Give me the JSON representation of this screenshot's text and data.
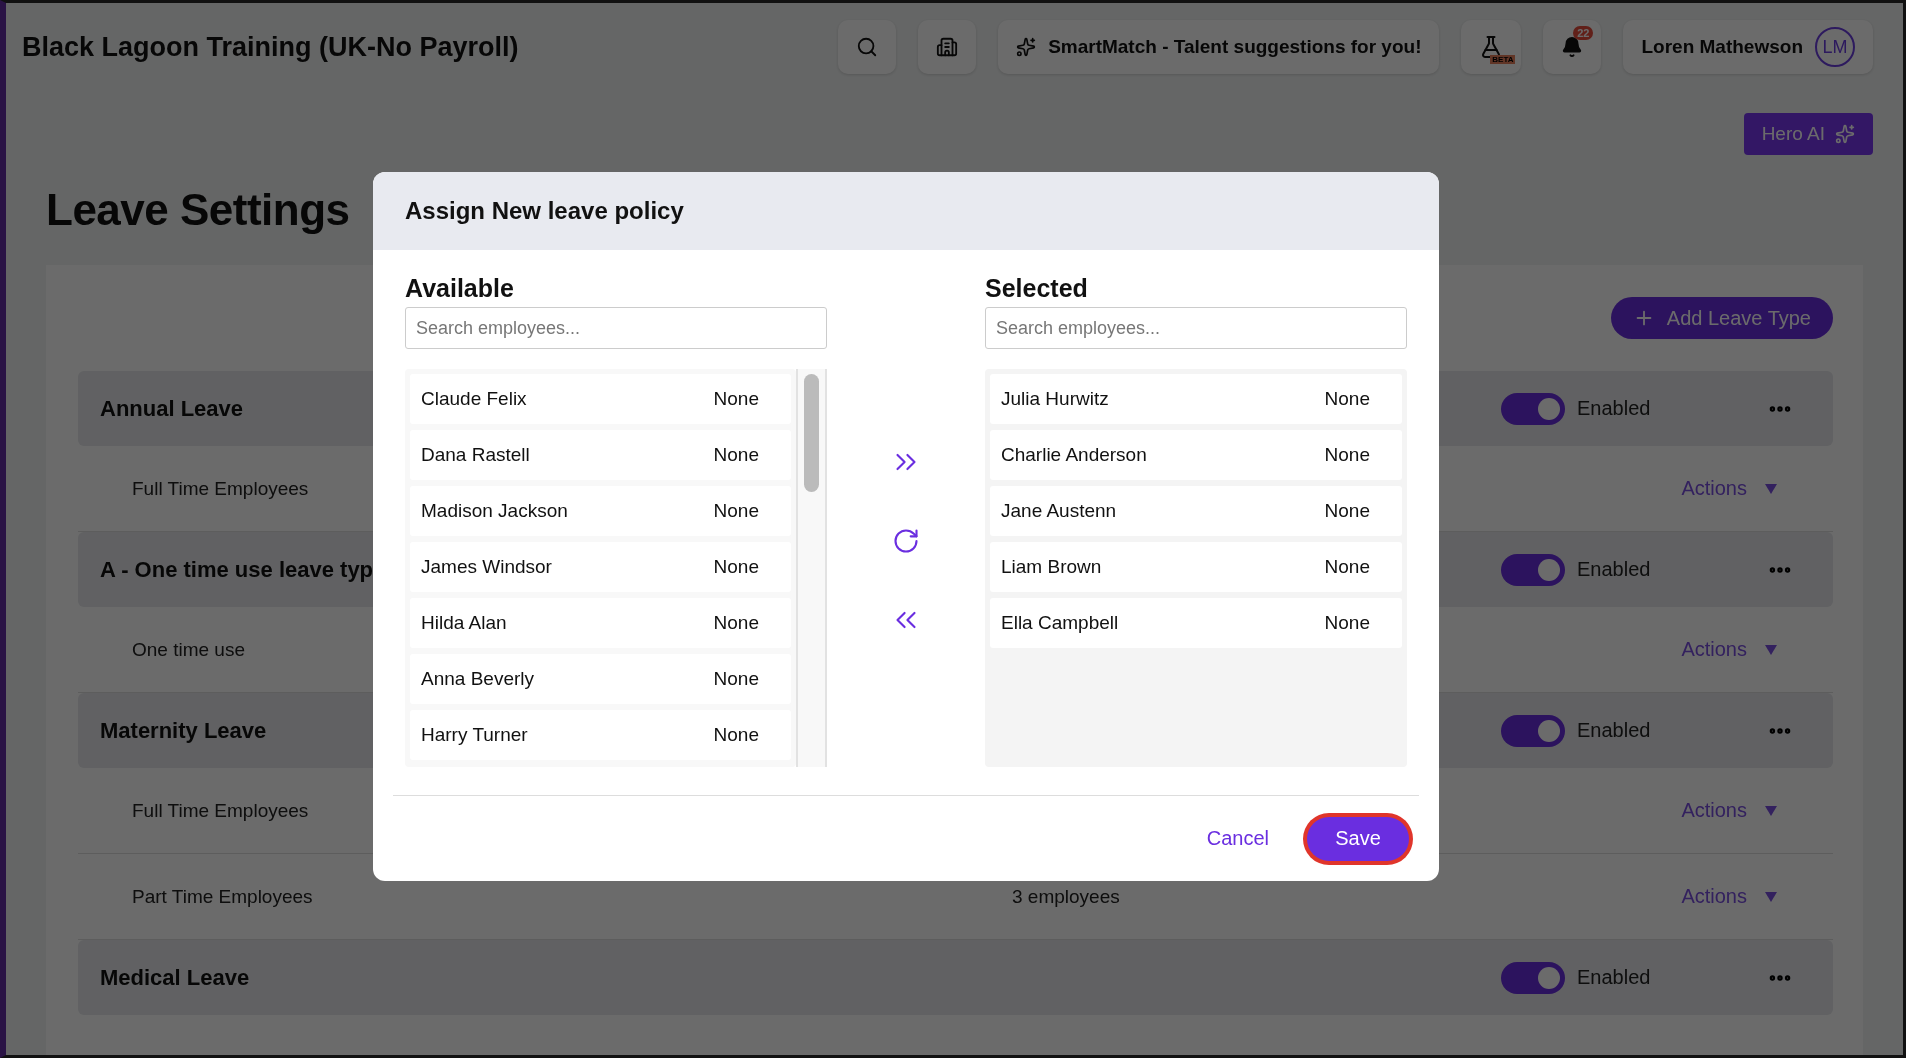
{
  "header": {
    "company": "Black Lagoon Training (UK-No Payroll)",
    "smartmatch": "SmartMatch - Talent suggestions for you!",
    "beta_badge": "BETA",
    "notification_count": "22",
    "user_name": "Loren Mathewson",
    "avatar_initials": "LM"
  },
  "hero_ai": "Hero AI",
  "page_title": "Leave Settings",
  "add_button": "Add Leave Type",
  "leave_types": [
    {
      "name": "Annual Leave",
      "enabled": true,
      "status": "Enabled",
      "policies": [
        {
          "name": "Full Time Employees",
          "action": "Actions"
        }
      ]
    },
    {
      "name": "A - One time use leave typ",
      "enabled": true,
      "status": "Enabled",
      "policies": [
        {
          "name": "One time use",
          "action": "Actions"
        }
      ]
    },
    {
      "name": "Maternity Leave",
      "enabled": true,
      "status": "Enabled",
      "policies": [
        {
          "name": "Full Time Employees",
          "action": "Actions"
        },
        {
          "name": "Part Time Employees",
          "employees": "3 employees",
          "action": "Actions"
        }
      ]
    },
    {
      "name": "Medical Leave",
      "enabled": true,
      "status": "Enabled"
    }
  ],
  "modal": {
    "title": "Assign New leave policy",
    "available": {
      "heading": "Available",
      "placeholder": "Search employees...",
      "items": [
        {
          "name": "Claude Felix",
          "value": "None"
        },
        {
          "name": "Dana Rastell",
          "value": "None"
        },
        {
          "name": "Madison Jackson",
          "value": "None"
        },
        {
          "name": "James Windsor",
          "value": "None"
        },
        {
          "name": "Hilda Alan",
          "value": "None"
        },
        {
          "name": "Anna Beverly",
          "value": "None"
        },
        {
          "name": "Harry Turner",
          "value": "None"
        }
      ]
    },
    "selected": {
      "heading": "Selected",
      "placeholder": "Search employees...",
      "items": [
        {
          "name": "Julia Hurwitz",
          "value": "None"
        },
        {
          "name": "Charlie Anderson",
          "value": "None"
        },
        {
          "name": "Jane Austenn",
          "value": "None"
        },
        {
          "name": "Liam Brown",
          "value": "None"
        },
        {
          "name": "Ella Campbell",
          "value": "None"
        }
      ]
    },
    "cancel": "Cancel",
    "save": {
      "label": "Save",
      "focused": true
    }
  }
}
